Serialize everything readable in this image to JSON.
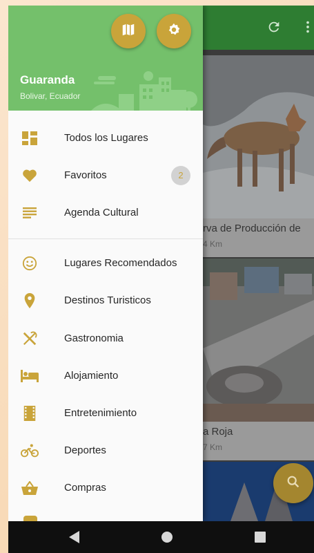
{
  "app": {
    "toolbar": {
      "refresh_icon": "refresh-icon",
      "more_icon": "more-vert-icon"
    },
    "cards": [
      {
        "title": "rva de Producción de",
        "distance": "4 Km"
      },
      {
        "title": "a Roja",
        "distance": "7 Km"
      }
    ],
    "fab_icon": "search-icon"
  },
  "drawer": {
    "header": {
      "city": "Guaranda",
      "region": "Bolivar, Ecuador",
      "map_button_icon": "map-icon",
      "settings_button_icon": "gear-icon"
    },
    "primary_items": [
      {
        "label": "Todos los Lugares",
        "icon": "dashboard-icon"
      },
      {
        "label": "Favoritos",
        "icon": "heart-icon",
        "badge": "2"
      },
      {
        "label": "Agenda Cultural",
        "icon": "notes-icon"
      }
    ],
    "category_items": [
      {
        "label": "Lugares Recomendados",
        "icon": "smiley-icon"
      },
      {
        "label": "Destinos Turisticos",
        "icon": "location-pin-icon"
      },
      {
        "label": "Gastronomia",
        "icon": "utensils-icon"
      },
      {
        "label": "Alojamiento",
        "icon": "bed-icon"
      },
      {
        "label": "Entretenimiento",
        "icon": "film-icon"
      },
      {
        "label": "Deportes",
        "icon": "bicycle-icon"
      },
      {
        "label": "Compras",
        "icon": "basket-icon"
      }
    ]
  },
  "system_nav": {
    "back_icon": "back-triangle-icon",
    "home_icon": "home-circle-icon",
    "recents_icon": "recents-square-icon"
  },
  "colors": {
    "accent": "#c9a43a",
    "header_green": "#74c06b",
    "toolbar_green": "#2e7d32"
  }
}
